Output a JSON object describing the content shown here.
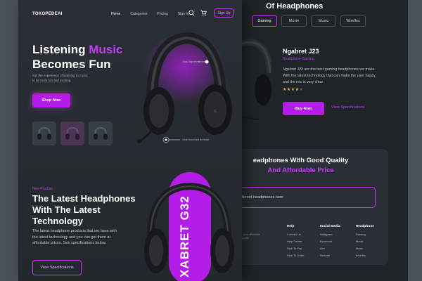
{
  "nav": {
    "logo": "TOKOPEDEAI",
    "links": [
      "Home",
      "Categories",
      "Pricing",
      "Sign In"
    ],
    "signup": "Sign Up"
  },
  "hero": {
    "title_line1_a": "Listening ",
    "title_line1_b": "Music",
    "title_line2": "Becomes Fun",
    "subtitle": "Get the experience of listening to music to be more fun and exciting",
    "shop_button": "Shop Now",
    "tips": [
      "Easy Adjustment",
      "Clear Sound And No Noise"
    ]
  },
  "new_section": {
    "tag": "New Product",
    "title": "The Latest Headphones With The Latest Technology",
    "description": "The latest headphone products that we have with the latest technology and you can get them at affordable prices. See specifications below.",
    "view_button": "View Specifications",
    "product_label": "XABRET G32"
  },
  "categories": {
    "title": "Of Headphones",
    "tabs": [
      "Gaming",
      "Movie",
      "Music",
      "Wirelles"
    ],
    "active_tab": "Gaming"
  },
  "product": {
    "name": "Ngabret J23",
    "category": "Headphone Gaming",
    "description": "Ngabret J23 are the best gaming headphones we make. With the latest technology that can make the user happy and the mic is very clear",
    "rating": 4,
    "rating_max": 5,
    "buy_button": "Buy Now",
    "spec_link": "View Specifications"
  },
  "newsletter": {
    "title_line1": "eadphones With Good Quality",
    "title_line2": "And Affordable Price",
    "input_placeholder": "eferred headphones here",
    "note": "ne show affordable at quality"
  },
  "footer": {
    "columns": [
      {
        "heading": "Help",
        "items": [
          "Contact Us",
          "Help Center",
          "How To Pay",
          "How To Order"
        ]
      },
      {
        "heading": "Social Media",
        "items": [
          "Instagram",
          "Facebook",
          "Line",
          "Youtube"
        ]
      },
      {
        "heading": "Headphone",
        "items": [
          "Gaming",
          "Movie",
          "Music",
          "Wirelles"
        ]
      }
    ]
  },
  "colors": {
    "accent": "#c43cf2",
    "button": "#b41de8",
    "panel": "#23282d",
    "star": "#f0c03a"
  }
}
